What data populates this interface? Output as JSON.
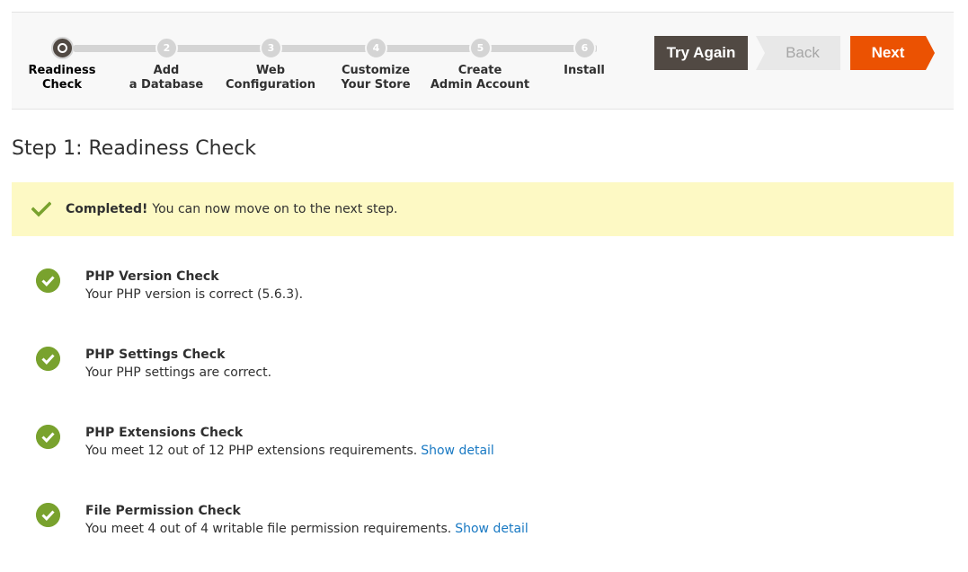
{
  "wizard": {
    "steps": [
      {
        "num": "",
        "line1": "Readiness",
        "line2": "Check",
        "active": true
      },
      {
        "num": "2",
        "line1": "Add",
        "line2": "a Database",
        "active": false
      },
      {
        "num": "3",
        "line1": "Web",
        "line2": "Configuration",
        "active": false
      },
      {
        "num": "4",
        "line1": "Customize",
        "line2": "Your Store",
        "active": false
      },
      {
        "num": "5",
        "line1": "Create",
        "line2": "Admin Account",
        "active": false
      },
      {
        "num": "6",
        "line1": "Install",
        "line2": "",
        "active": false
      }
    ],
    "buttons": {
      "try_again": "Try Again",
      "back": "Back",
      "next": "Next"
    }
  },
  "page": {
    "title": "Step 1: Readiness Check"
  },
  "alert": {
    "strong": "Completed!",
    "text": "You can now move on to the next step."
  },
  "checks": [
    {
      "title": "PHP Version Check",
      "desc": "Your PHP version is correct (5.6.3).",
      "link": ""
    },
    {
      "title": "PHP Settings Check",
      "desc": "Your PHP settings are correct.",
      "link": ""
    },
    {
      "title": "PHP Extensions Check",
      "desc": "You meet 12 out of 12 PHP extensions requirements.",
      "link": "Show detail"
    },
    {
      "title": "File Permission Check",
      "desc": "You meet 4 out of 4 writable file permission requirements.",
      "link": "Show detail"
    }
  ],
  "colors": {
    "accent": "#eb5202",
    "dark_button": "#514943",
    "success": "#79a22e",
    "alert_bg": "#fdf9c4",
    "link": "#1979c3"
  }
}
